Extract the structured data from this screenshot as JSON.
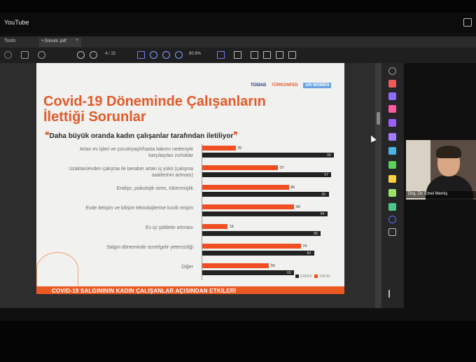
{
  "youtube": {
    "title": "YouTube"
  },
  "pdf": {
    "tools_label": "Tools",
    "tab_label": "• Sonum .pdf",
    "tab_close": "×",
    "page_indicator": "4 / 15",
    "zoom": "80.8%"
  },
  "slide": {
    "logos": [
      "TÜSİAD",
      "TÜRKONFED",
      "UN WOMEN"
    ],
    "title_line1": "Covid-19 Döneminde Çalışanların",
    "title_line2": "İlettiği Sorunlar",
    "subtitle": "Daha büyük oranda kadın çalışanlar tarafından iletiliyor",
    "quote_open": "❝",
    "quote_close": "❞",
    "footer": "COVID-19 SALGINININ KADIN ÇALIŞANLAR AÇISINDAN ETKİLERİ",
    "legend": {
      "male": "ERKEK",
      "female": "KADIN"
    }
  },
  "chart_data": {
    "type": "bar",
    "orientation": "horizontal",
    "categories": [
      "Artan ev işleri ve çocuk/yaşlı/hasta bakımı nedeniyle karşılaşılan zorluklar",
      "Uzaktan/evden çalışma ile beraber artan iş yükü (çalışma saatlerinin artması)",
      "Endişe, psikolojik stres, tükenmişlik",
      "Evde iletişim ve bilişim teknolojilerine kısıtlı erişim",
      "Ev içi şiddetin artması",
      "Salgın döneminde ücret/gelir yetersizliği",
      "Diğer"
    ],
    "series": [
      {
        "name": "KADIN",
        "color": "#f04e23",
        "values": [
          25,
          57,
          65,
          69,
          19,
          74,
          50
        ]
      },
      {
        "name": "ERKEK",
        "color": "#222222",
        "values": [
          99,
          97,
          95,
          94,
          89,
          84,
          69
        ]
      }
    ],
    "xlim": [
      0,
      100
    ],
    "grid": false,
    "legend": "bottom-right"
  },
  "webcam": {
    "name": "Doç. Dr. Emel Memiş"
  }
}
